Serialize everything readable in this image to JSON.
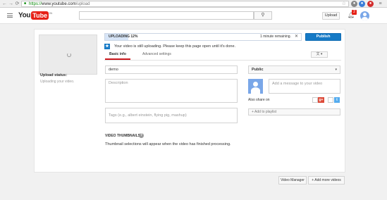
{
  "browser": {
    "url_scheme": "https://",
    "url_host": "www.youtube.com",
    "url_path": "/upload"
  },
  "header": {
    "logo_you": "You",
    "logo_tube": "Tube",
    "logo_country": "IN",
    "search_placeholder": "",
    "upload_label": "Upload",
    "notification_count": "2"
  },
  "upload": {
    "status_label": "Upload status:",
    "status_text": "Uploading your video.",
    "progress_label": "UPLOADING 12%",
    "progress_fraction": 0.12,
    "time_remaining": "1 minute remaining.",
    "cancel_symbol": "✕",
    "publish_label": "Publish",
    "info_message": "Your video is still uploading. Please keep this page open until it's done."
  },
  "tabs": {
    "basic_info": "Basic info",
    "advanced_settings": "Advanced settings"
  },
  "form": {
    "title_value": "demo",
    "description_placeholder": "Description",
    "tags_placeholder": "Tags (e.g., albert einstein, flying pig, mashup)",
    "privacy_value": "Public",
    "share_message_placeholder": "Add a message to your video",
    "also_share_label": "Also share on",
    "add_to_playlist": "+ Add to playlist"
  },
  "thumbnails": {
    "heading": "VIDEO THUMBNAILS",
    "message": "Thumbnail selections will appear when the video has finished processing."
  },
  "footer_buttons": {
    "video_manager": "Video Manager",
    "add_more_videos": "+ Add more videos"
  },
  "colors": {
    "accent_blue": "#167ac6",
    "brand_red": "#e62117",
    "progress_fill": "#d7e5f7"
  }
}
